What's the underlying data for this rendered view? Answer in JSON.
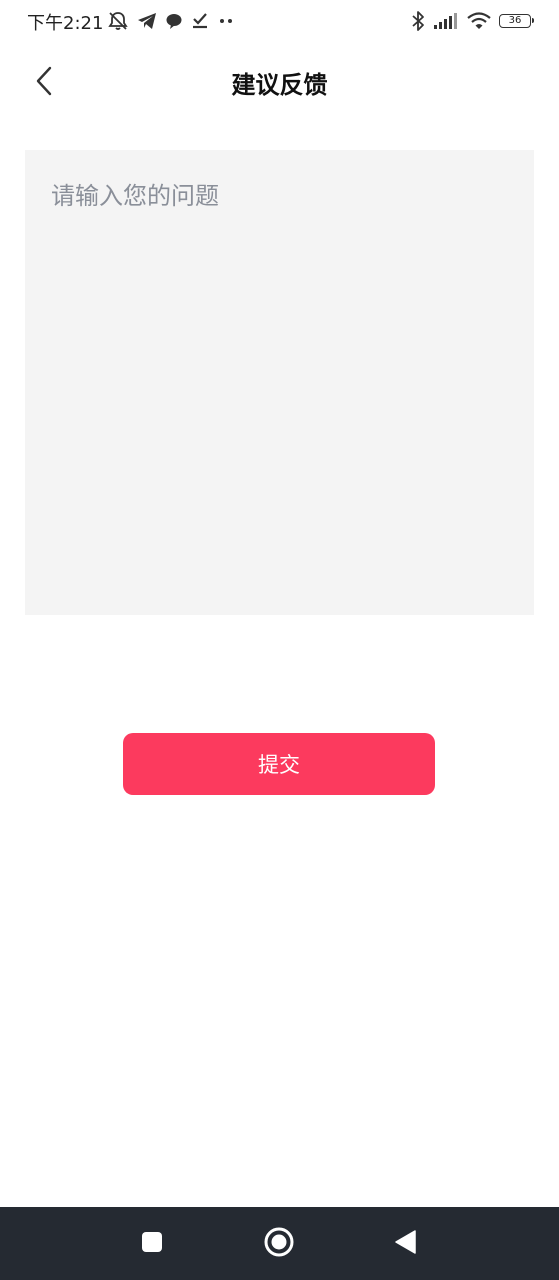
{
  "status_bar": {
    "time": "下午2:21",
    "battery_level": "36",
    "left_icons": [
      "mute-icon",
      "telegram-icon",
      "chat-bubble-icon",
      "download-check-icon",
      "more-dots-icon"
    ],
    "right_icons": [
      "bluetooth-icon",
      "signal-icon",
      "wifi-icon",
      "battery-icon"
    ]
  },
  "header": {
    "title": "建议反馈",
    "back_icon": "chevron-left-icon"
  },
  "feedback": {
    "value": "",
    "placeholder": "请输入您的问题"
  },
  "submit": {
    "label": "提交"
  },
  "nav_bar": {
    "buttons": [
      "recent-apps-icon",
      "home-icon",
      "back-triangle-icon"
    ]
  },
  "colors": {
    "accent": "#fc3a5e",
    "input_background": "#f4f4f4",
    "nav_background": "#252a32",
    "placeholder": "#8a8f99"
  }
}
